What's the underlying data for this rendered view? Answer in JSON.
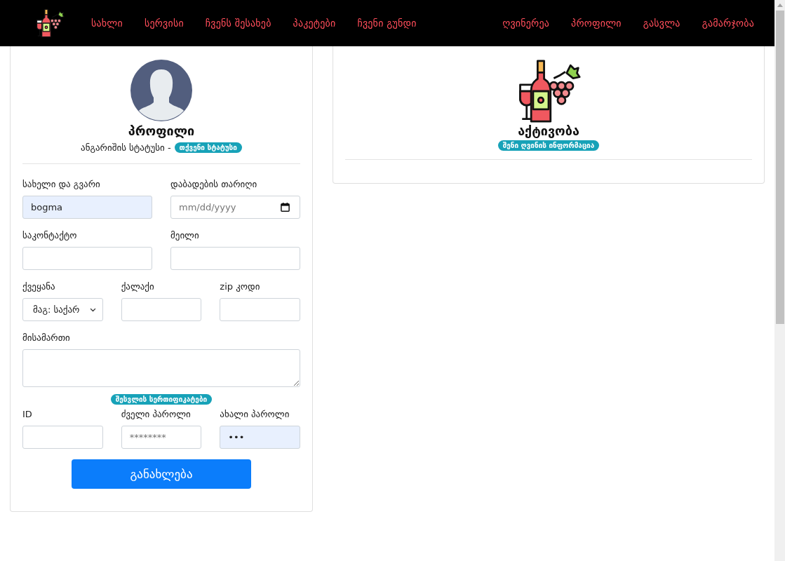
{
  "navbar": {
    "links": [
      "სახლი",
      "სერვისი",
      "ჩვენს შესახებ",
      "პაკეტები",
      "ჩვენი გუნდი"
    ],
    "right_links": [
      "ღვინერეა",
      "პროფილი",
      "გასვლა",
      "გამარჯობა"
    ]
  },
  "profile": {
    "title": "პროფილი",
    "status_label": "ანგარიშის სტატუსი -",
    "status_badge": "თქვენი სტატუსი",
    "rows": [
      {
        "fields": [
          {
            "kind": "text",
            "label": "სახელი და გვარი",
            "value": "bogma",
            "autofilled": true
          },
          {
            "kind": "date",
            "label": "დაბადების თარიღი",
            "placeholder": "mm/dd/yyyy",
            "autofilled": false
          }
        ]
      },
      {
        "fields": [
          {
            "kind": "text",
            "label": "საკონტაქტო",
            "autofilled": false
          },
          {
            "kind": "text",
            "label": "მეილი",
            "autofilled": false
          }
        ]
      },
      {
        "fields": [
          {
            "kind": "select",
            "label": "ქვეყანა",
            "value": "მაგ: საქარ",
            "autofilled": false
          },
          {
            "kind": "text",
            "label": "ქალაქი",
            "autofilled": false
          },
          {
            "kind": "text",
            "label": "zip კოდი",
            "autofilled": false
          }
        ]
      },
      {
        "fields": [
          {
            "kind": "textarea",
            "label": "მისამართი",
            "autofilled": false
          }
        ]
      },
      {
        "badge": "შესვლის სერთიფიკატები",
        "fields": [
          {
            "kind": "text",
            "label": "ID",
            "autofilled": false
          },
          {
            "kind": "text",
            "label": "ძველი პაროლი",
            "placeholder": "********",
            "autofilled": false
          },
          {
            "kind": "text",
            "label": "ახალი პაროლი",
            "value": "•••",
            "autofilled": true
          }
        ]
      }
    ],
    "button": "განახლება"
  },
  "activity": {
    "title": "აქტივობა",
    "badge": "შენი ღვინის ინფორმაცია"
  }
}
